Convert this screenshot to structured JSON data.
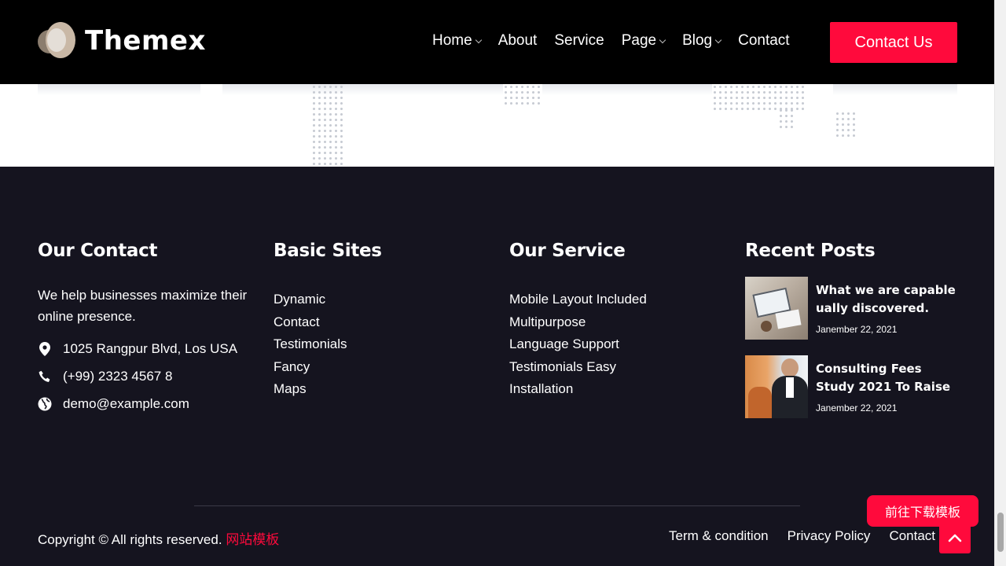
{
  "header": {
    "brand": "Themex",
    "nav": [
      {
        "label": "Home",
        "dropdown": true
      },
      {
        "label": "About",
        "dropdown": false
      },
      {
        "label": "Service",
        "dropdown": false
      },
      {
        "label": "Page",
        "dropdown": true
      },
      {
        "label": "Blog",
        "dropdown": true
      },
      {
        "label": "Contact",
        "dropdown": false
      }
    ],
    "cta_label": "Contact Us"
  },
  "footer": {
    "contact": {
      "title": "Our Contact",
      "description": "We help businesses maximize their online presence.",
      "address": "1025 Rangpur Blvd, Los USA",
      "phone": "(+99) 2323 4567 8",
      "email": "demo@example.com"
    },
    "basic_sites": {
      "title": "Basic Sites",
      "items": [
        "Dynamic",
        "Contact",
        "Testimonials",
        "Fancy",
        "Maps"
      ]
    },
    "our_service": {
      "title": "Our Service",
      "items": [
        "Mobile Layout Included",
        "Multipurpose",
        "Language Support",
        "Testimonials Easy",
        "Installation"
      ]
    },
    "recent_posts": {
      "title": "Recent Posts",
      "posts": [
        {
          "title": "What we are capable ually discovered.",
          "date": "Janember 22, 2021"
        },
        {
          "title": "Consulting Fees Study 2021 To Raise",
          "date": "Janember 22, 2021"
        }
      ]
    },
    "copyright_text": "Copyright © All rights reserved.",
    "copyright_link": "网站模板",
    "bottom_links": [
      "Term & condition",
      "Privacy Policy",
      "Contact"
    ]
  },
  "floating": {
    "download_label": "前往下载模板"
  },
  "colors": {
    "accent": "#ff0a3c",
    "header_bg": "#000000",
    "footer_bg": "#15141f"
  }
}
